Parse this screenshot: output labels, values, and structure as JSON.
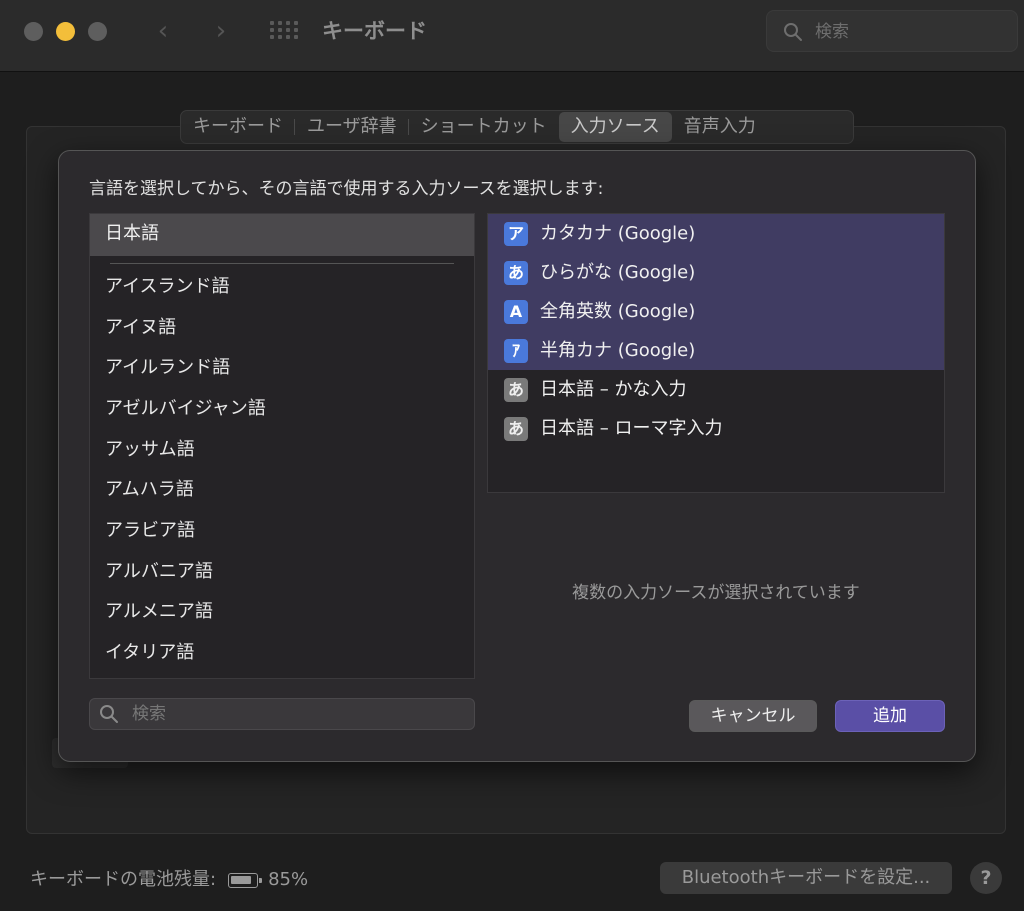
{
  "window": {
    "title": "キーボード",
    "search_placeholder": "検索",
    "back_icon": "chevron-left-icon",
    "forward_icon": "chevron-right-icon"
  },
  "tabs": [
    {
      "label": "キーボード",
      "active": false
    },
    {
      "label": "ユーザ辞書",
      "active": false
    },
    {
      "label": "ショートカット",
      "active": false
    },
    {
      "label": "入力ソース",
      "active": true
    },
    {
      "label": "音声入力",
      "active": false
    }
  ],
  "sheet": {
    "instruction": "言語を選択してから、その言語で使用する入力ソースを選択します:",
    "selected_language": "日本語",
    "languages": [
      "アイスランド語",
      "アイヌ語",
      "アイルランド語",
      "アゼルバイジャン語",
      "アッサム語",
      "アムハラ語",
      "アラビア語",
      "アルバニア語",
      "アルメニア語",
      "イタリア語"
    ],
    "sources": [
      {
        "glyph": "ア",
        "label": "カタカナ (Google)",
        "selected": true,
        "icon_style": "blue"
      },
      {
        "glyph": "あ",
        "label": "ひらがな (Google)",
        "selected": true,
        "icon_style": "blue"
      },
      {
        "glyph": "A",
        "label": "全角英数 (Google)",
        "selected": true,
        "icon_style": "blue"
      },
      {
        "glyph": "ｱ",
        "label": "半角カナ (Google)",
        "selected": true,
        "icon_style": "blue"
      },
      {
        "glyph": "あ",
        "label": "日本語 – かな入力",
        "selected": false,
        "icon_style": "gray"
      },
      {
        "glyph": "あ",
        "label": "日本語 – ローマ字入力",
        "selected": false,
        "icon_style": "gray"
      }
    ],
    "multi_selected_message": "複数の入力ソースが選択されています",
    "search_placeholder": "検索",
    "cancel_label": "キャンセル",
    "add_label": "追加"
  },
  "footer": {
    "battery_label": "キーボードの電池残量:",
    "battery_percent": "85%",
    "battery_level": 0.85,
    "bluetooth_button": "Bluetoothキーボードを設定...",
    "help_label": "?"
  },
  "colors": {
    "accent": "#5a4fa6",
    "selection": "#403c62",
    "source_icon_blue": "#4a79db",
    "minimize": "#f3be3a"
  }
}
